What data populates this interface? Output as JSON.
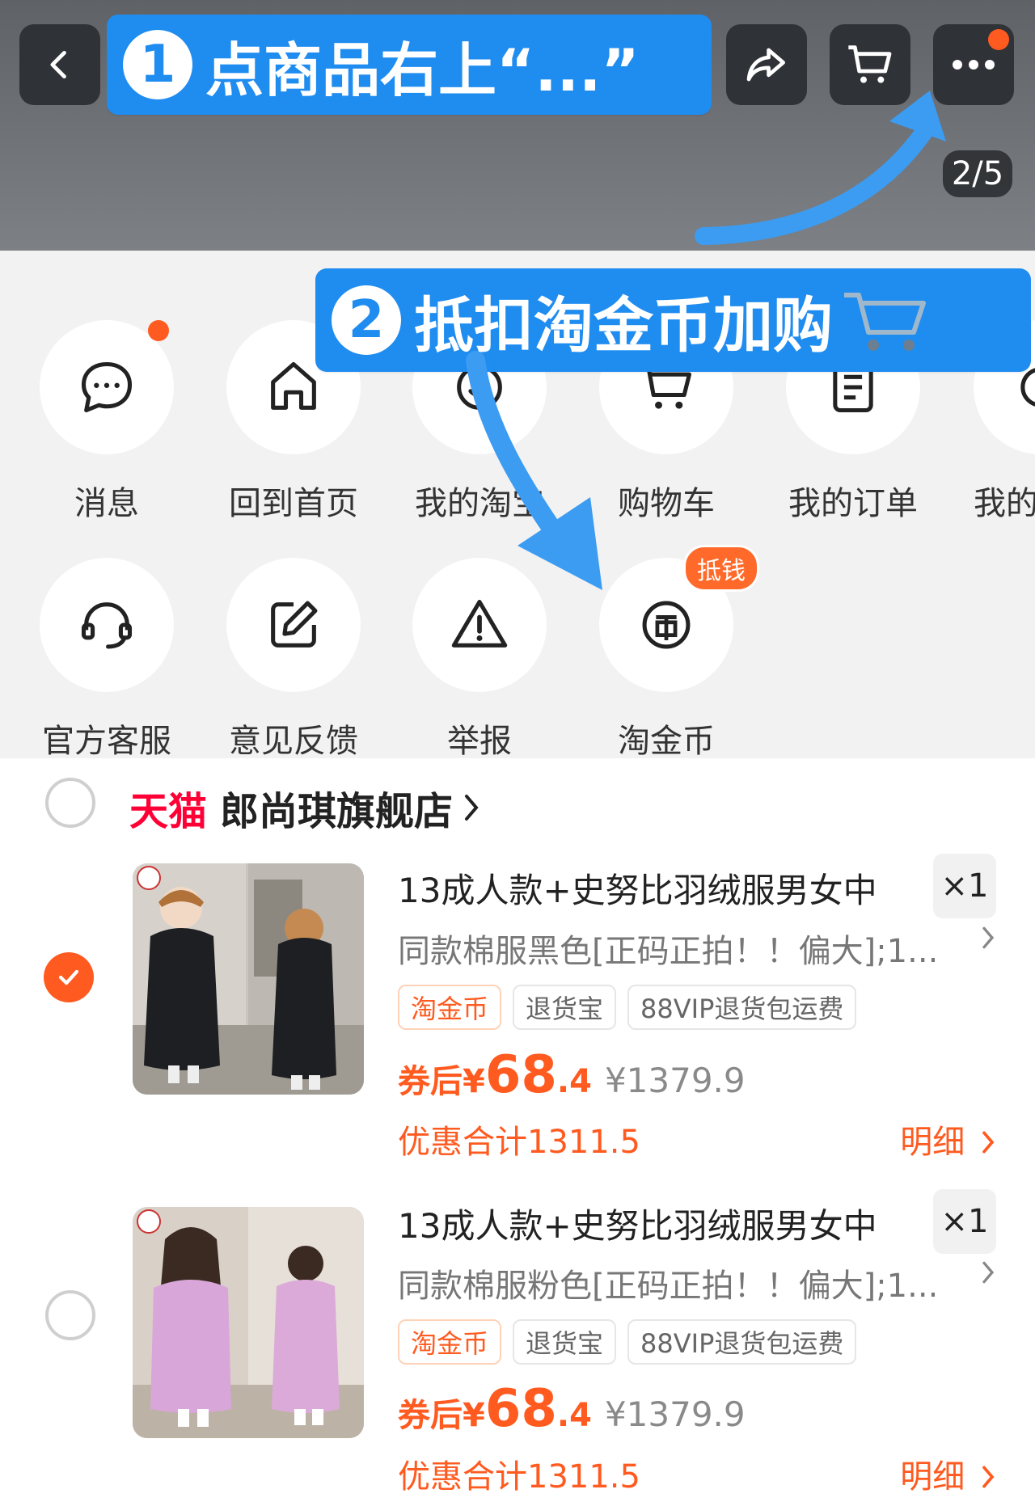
{
  "header": {
    "back_icon": "back-chevron-icon",
    "share_icon": "share-icon",
    "cart_icon": "cart-icon",
    "more_icon": "more-dots-icon",
    "image_counter": "2/5"
  },
  "annotations": {
    "step1": {
      "number": "1",
      "text": "点商品右上“...”"
    },
    "step2": {
      "number": "2",
      "text": "抵扣淘金币加购"
    }
  },
  "menu": {
    "row1": [
      {
        "label": "消息",
        "icon": "message-icon"
      },
      {
        "label": "回到首页",
        "icon": "home-icon"
      },
      {
        "label": "我的淘宝",
        "icon": "profile-icon"
      },
      {
        "label": "购物车",
        "icon": "cart-icon"
      },
      {
        "label": "我的订单",
        "icon": "order-icon"
      },
      {
        "label": "我的",
        "icon": "more-icon"
      }
    ],
    "row2": [
      {
        "label": "官方客服",
        "icon": "headset-icon"
      },
      {
        "label": "意见反馈",
        "icon": "edit-icon"
      },
      {
        "label": "举报",
        "icon": "warning-icon"
      },
      {
        "label": "淘金币",
        "icon": "coin-icon",
        "badge": "抵钱"
      }
    ]
  },
  "store": {
    "brand": "天猫",
    "name": "郎尚琪旗舰店"
  },
  "items": [
    {
      "checked": true,
      "title": "13成人款+史努比羽绒服男女中",
      "qty": "×1",
      "variant": "同款棉服黑色[正码正拍！！偏大];1...",
      "tags": [
        "淘金币",
        "退货宝",
        "88VIP退货包运费"
      ],
      "price_label": "券后",
      "currency": "¥",
      "price_int": "68",
      "price_dec": ".4",
      "original_price": "¥1379.9",
      "discount": "优惠合计1311.5",
      "detail": "明细"
    },
    {
      "checked": false,
      "title": "13成人款+史努比羽绒服男女中",
      "qty": "×1",
      "variant": "同款棉服粉色[正码正拍！！偏大];1...",
      "tags": [
        "淘金币",
        "退货宝",
        "88VIP退货包运费"
      ],
      "price_label": "券后",
      "currency": "¥",
      "price_int": "68",
      "price_dec": ".4",
      "original_price": "¥1379.9",
      "discount": "优惠合计1311.5",
      "detail": "明细"
    }
  ],
  "colors": {
    "accent_orange": "#ff5a1f",
    "callout_blue": "#1f8cf0",
    "tmall_red": "#ff0036"
  }
}
